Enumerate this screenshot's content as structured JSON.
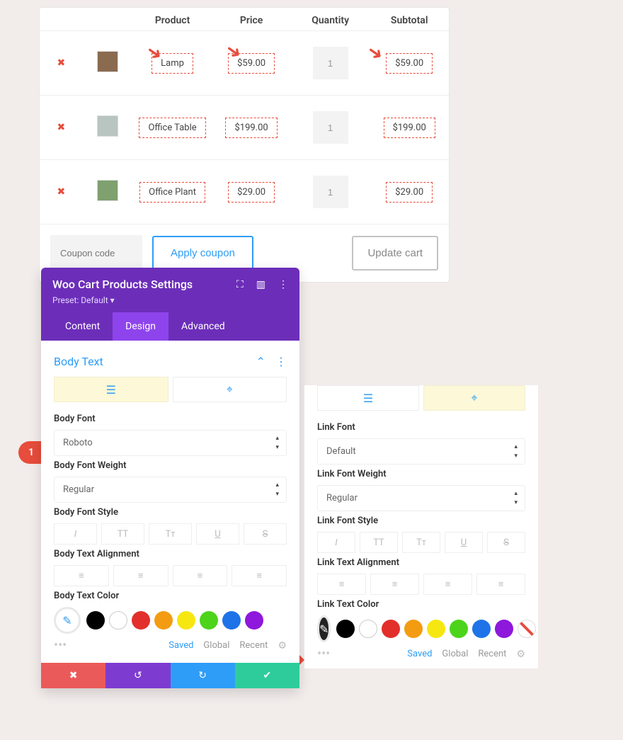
{
  "cart": {
    "headers": {
      "product": "Product",
      "price": "Price",
      "quantity": "Quantity",
      "subtotal": "Subtotal"
    },
    "rows": [
      {
        "remove": "✖",
        "thumb": "#8a6b4f",
        "product": "Lamp",
        "price": "$59.00",
        "qty": "1",
        "subtotal": "$59.00"
      },
      {
        "remove": "✖",
        "thumb": "#b8c5c0",
        "product": "Office Table",
        "price": "$199.00",
        "qty": "1",
        "subtotal": "$199.00"
      },
      {
        "remove": "✖",
        "thumb": "#7fa06f",
        "product": "Office Plant",
        "price": "$29.00",
        "qty": "1",
        "subtotal": "$29.00"
      }
    ],
    "coupon_placeholder": "Coupon code",
    "apply": "Apply coupon",
    "update": "Update cart"
  },
  "panel": {
    "title": "Woo Cart Products Settings",
    "preset": "Preset: Default ▾",
    "tabs": {
      "content": "Content",
      "design": "Design",
      "advanced": "Advanced"
    },
    "section_title": "Body Text",
    "body": {
      "toggle_text": "text",
      "toggle_link": "link",
      "font_label": "Body Font",
      "font_value": "Roboto",
      "weight_label": "Body Font Weight",
      "weight_value": "Regular",
      "style_label": "Body Font Style",
      "style_opts": [
        "I",
        "TT",
        "Tᴛ",
        "U",
        "S"
      ],
      "align_label": "Body Text Alignment",
      "color_label": "Body Text Color",
      "palette": {
        "saved": "Saved",
        "global": "Global",
        "recent": "Recent"
      }
    }
  },
  "panel2": {
    "font_label": "Link Font",
    "font_value": "Default",
    "weight_label": "Link Font Weight",
    "weight_value": "Regular",
    "style_label": "Link Font Style",
    "style_opts": [
      "I",
      "TT",
      "Tᴛ",
      "U",
      "S"
    ],
    "align_label": "Link Text Alignment",
    "color_label": "Link Text Color",
    "palette": {
      "saved": "Saved",
      "global": "Global",
      "recent": "Recent"
    }
  },
  "colors": [
    "#000000",
    "#ffffff",
    "#e22f2b",
    "#f39c12",
    "#f6e711",
    "#4cd41a",
    "#1e73e8",
    "#8e18db",
    "#ff4fc2"
  ],
  "chart_data": {
    "type": "table",
    "title": "Cart products",
    "columns": [
      "Product",
      "Price",
      "Quantity",
      "Subtotal"
    ],
    "rows": [
      [
        "Lamp",
        59.0,
        1,
        59.0
      ],
      [
        "Office Table",
        199.0,
        1,
        199.0
      ],
      [
        "Office Plant",
        29.0,
        1,
        29.0
      ]
    ]
  }
}
